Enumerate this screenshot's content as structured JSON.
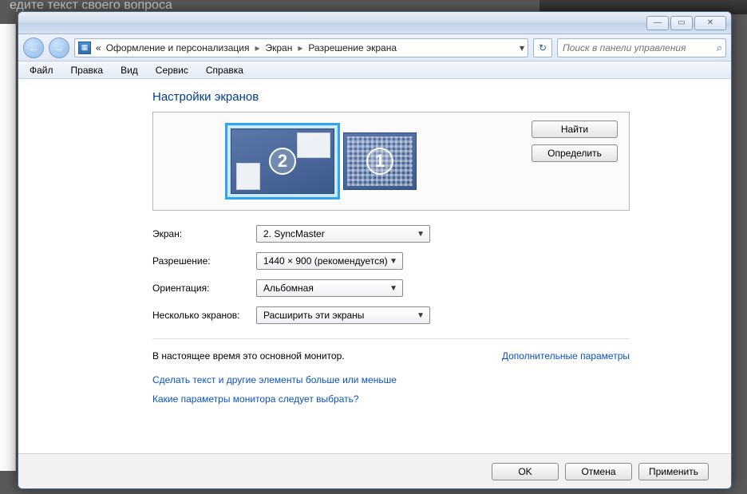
{
  "titlebar": {
    "minimize": "—",
    "maximize": "▭",
    "close": "✕"
  },
  "nav": {
    "back": "←",
    "fwd": "→",
    "prefix": "«",
    "crumbs": [
      "Оформление и персонализация",
      "Экран",
      "Разрешение экрана"
    ],
    "sep": "▸",
    "dropdown": "▾",
    "refresh": "↻",
    "search_placeholder": "Поиск в панели управления"
  },
  "menu": [
    "Файл",
    "Правка",
    "Вид",
    "Сервис",
    "Справка"
  ],
  "page": {
    "title": "Настройки экранов",
    "monitors": {
      "primary": "2",
      "secondary": "1"
    },
    "find_btn": "Найти",
    "identify_btn": "Определить",
    "labels": {
      "screen": "Экран:",
      "resolution": "Разрешение:",
      "orientation": "Ориентация:",
      "multi": "Несколько экранов:"
    },
    "values": {
      "screen": "2. SyncMaster",
      "resolution": "1440 × 900 (рекомендуется)",
      "orientation": "Альбомная",
      "multi": "Расширить эти экраны"
    },
    "status": "В настоящее время это основной монитор.",
    "advanced_link": "Дополнительные параметры",
    "link_textsize": "Сделать текст и другие элементы больше или меньше",
    "link_which": "Какие параметры монитора следует выбрать?"
  },
  "footer": {
    "ok": "OK",
    "cancel": "Отмена",
    "apply": "Применить"
  }
}
